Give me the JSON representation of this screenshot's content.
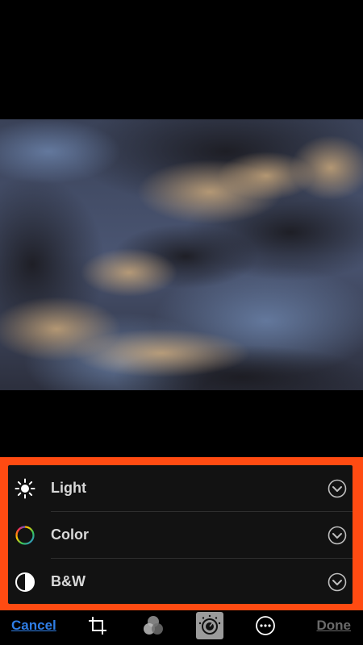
{
  "panel": {
    "items": [
      {
        "label": "Light",
        "icon": "sun-icon"
      },
      {
        "label": "Color",
        "icon": "color-wheel-icon"
      },
      {
        "label": "B&W",
        "icon": "half-circle-icon"
      }
    ],
    "highlight_color": "#ff4b12"
  },
  "toolbar": {
    "cancel_label": "Cancel",
    "done_label": "Done",
    "tools": [
      "crop-icon",
      "filters-icon",
      "adjust-icon",
      "more-icon"
    ],
    "active_tool": "adjust-icon",
    "accent_color": "#2f7ee6"
  }
}
